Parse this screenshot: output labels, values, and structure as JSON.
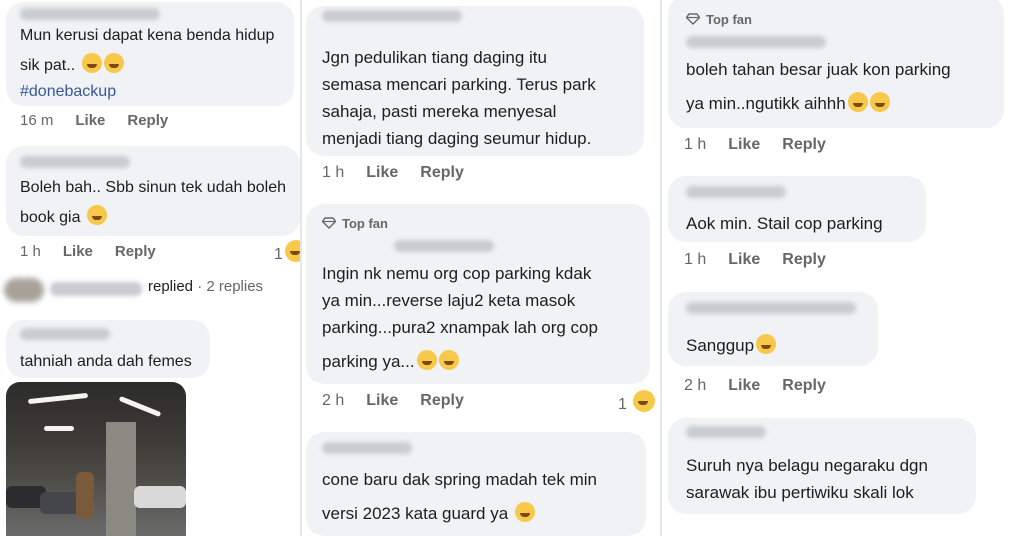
{
  "col1": {
    "c1": {
      "lines": [
        "Mun kerusi dapat kena benda hidup",
        "sik pat.."
      ],
      "hashtag": "#donebackup",
      "time": "16 m",
      "like": "Like",
      "reply": "Reply"
    },
    "c2": {
      "lines": [
        "Boleh bah.. Sbb sinun tek udah boleh",
        "book gia"
      ],
      "time": "1 h",
      "like": "Like",
      "reply": "Reply",
      "reactions": "1"
    },
    "replied": {
      "text": "replied",
      "count": " · 2 replies"
    },
    "c3": {
      "lines": [
        "tahniah anda dah femes"
      ]
    }
  },
  "col2": {
    "c1": {
      "lines": [
        "Jgn pedulikan tiang daging itu",
        "semasa mencari parking. Terus park",
        "sahaja, pasti mereka menyesal",
        "menjadi tiang daging seumur hidup."
      ],
      "time": "1 h",
      "like": "Like",
      "reply": "Reply"
    },
    "c2": {
      "badge": "Top fan",
      "lines": [
        "Ingin nk nemu org cop parking kdak",
        "ya min...reverse laju2 keta masok",
        "parking...pura2 xnampak lah org cop",
        "parking ya..."
      ],
      "time": "2 h",
      "like": "Like",
      "reply": "Reply",
      "reactions": "1"
    },
    "c3": {
      "lines": [
        "cone baru dak spring madah tek min",
        "versi 2023 kata guard ya"
      ]
    }
  },
  "col3": {
    "c1": {
      "badge": "Top fan",
      "lines": [
        "boleh tahan besar juak kon parking",
        "ya min..ngutikk aihhh"
      ],
      "time": "1 h",
      "like": "Like",
      "reply": "Reply"
    },
    "c2": {
      "lines": [
        "Aok min. Stail cop parking"
      ],
      "time": "1 h",
      "like": "Like",
      "reply": "Reply"
    },
    "c3": {
      "lines": [
        "Sanggup"
      ],
      "time": "2 h",
      "like": "Like",
      "reply": "Reply"
    },
    "c4": {
      "lines": [
        "Suruh nya belagu negaraku dgn",
        "sarawak ibu pertiwiku skali lok"
      ]
    }
  },
  "colors": {
    "bubble": "#f0f2f5",
    "meta": "#65676b",
    "hashtag": "#385898",
    "emoji": "#f7c84a"
  },
  "icons": [
    "diamond-icon",
    "grinning-sweat-emoji",
    "grimacing-emoji",
    "laughing-emoji",
    "rolling-laughing-emoji"
  ]
}
